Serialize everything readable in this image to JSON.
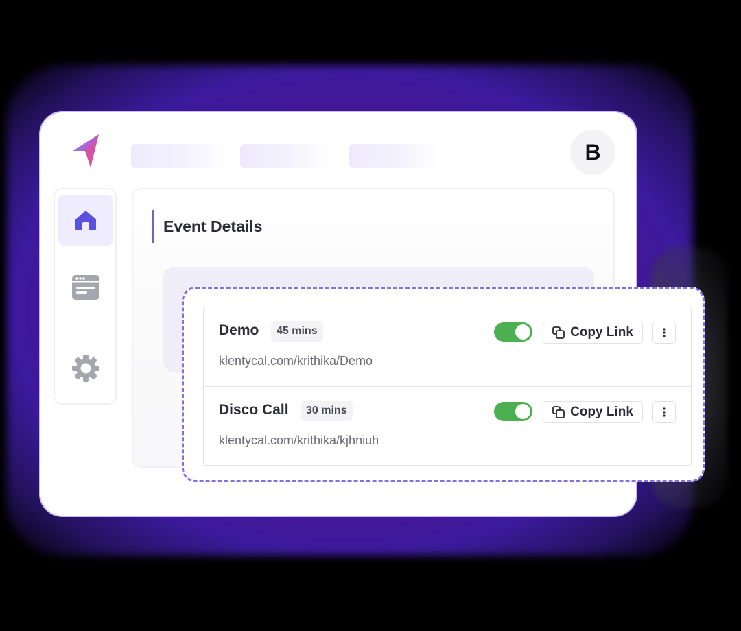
{
  "app": {
    "logo": "paper-plane-logo-icon",
    "avatar_initial": "B",
    "accent_color": "#5b4fe0",
    "border_accent": "#8271de"
  },
  "sidebar": {
    "items": [
      {
        "name": "home",
        "icon": "home-icon",
        "active": true
      },
      {
        "name": "browser",
        "icon": "browser-window-icon",
        "active": false
      },
      {
        "name": "settings",
        "icon": "gear-icon",
        "active": false
      }
    ]
  },
  "main": {
    "title": "Event Details"
  },
  "events": [
    {
      "name": "Demo",
      "duration": "45 mins",
      "url": "klentycal.com/krithika/Demo",
      "enabled": true,
      "copy_label": "Copy Link"
    },
    {
      "name": "Disco Call",
      "duration": "30 mins",
      "url": "klentycal.com/krithika/kjhniuh",
      "enabled": true,
      "copy_label": "Copy Link"
    }
  ]
}
